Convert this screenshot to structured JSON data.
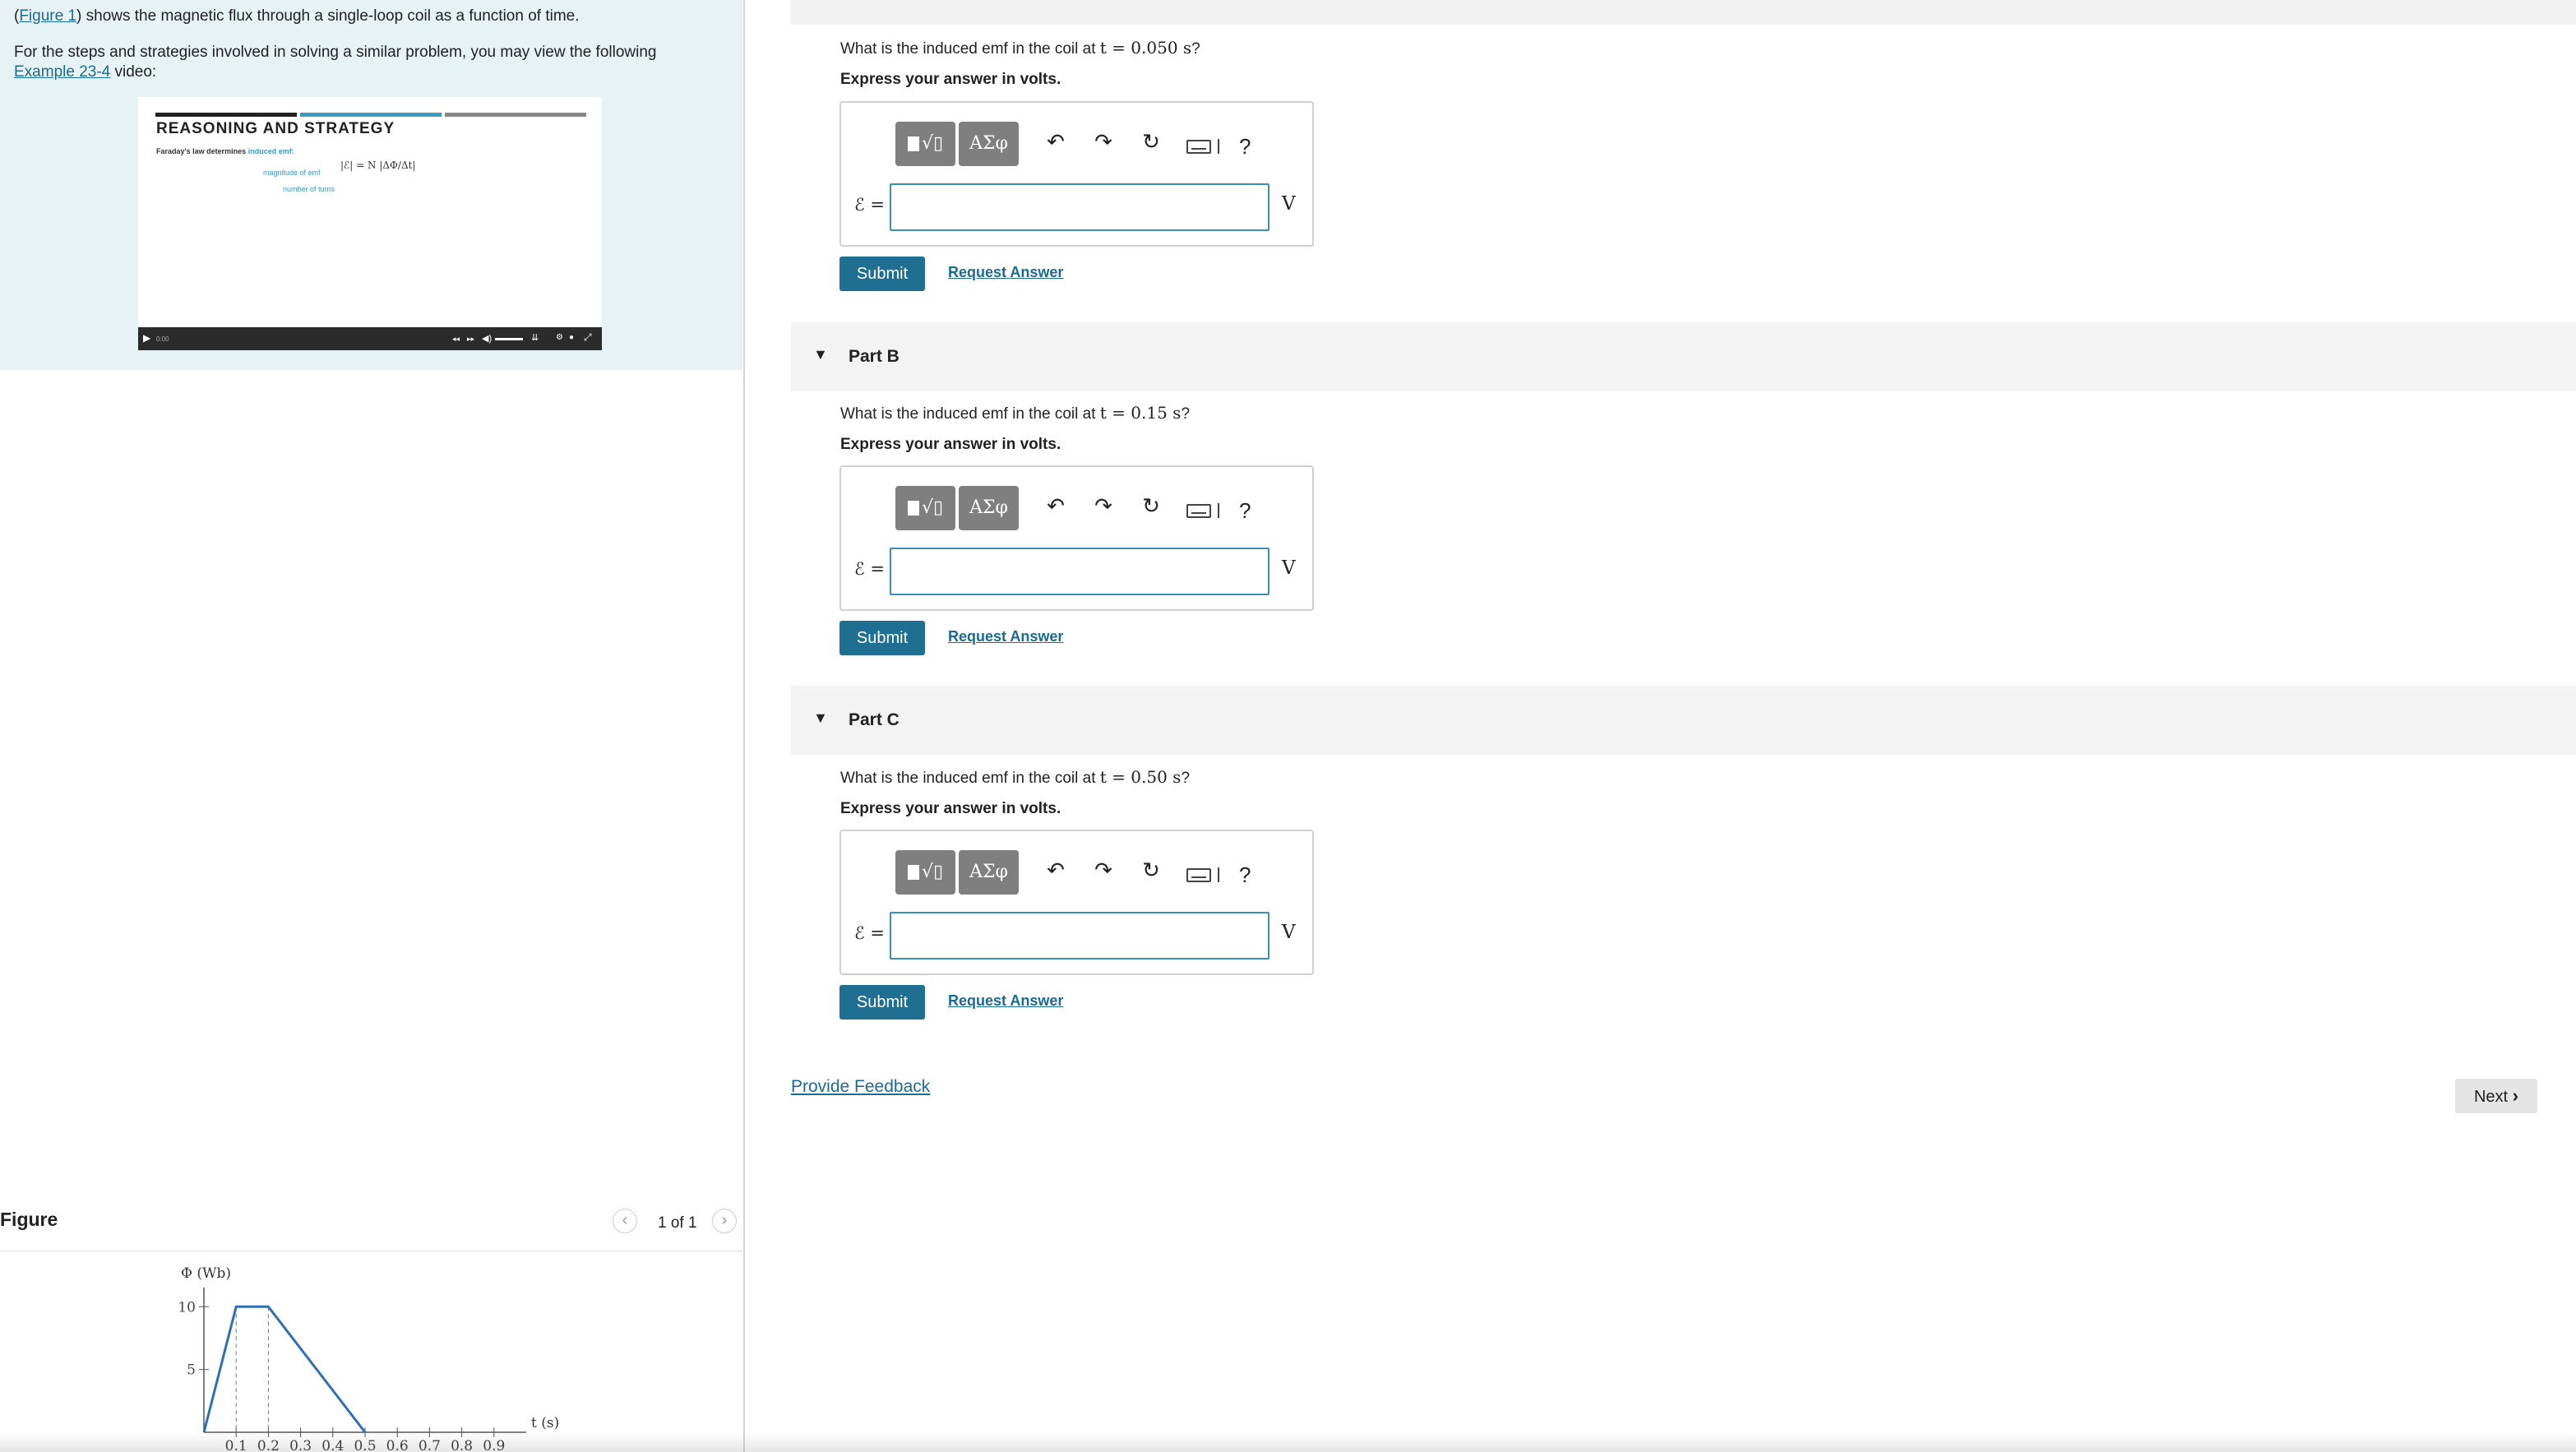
{
  "intro": {
    "figure_link": "Figure 1",
    "line1_open": "(",
    "line1_rest": ") shows the magnetic flux through a single-loop coil as a function of time.",
    "line2": "For the steps and strategies involved in solving a similar problem, you may view the following",
    "example_link": "Example 23-4",
    "line3_rest": " video:"
  },
  "video": {
    "heading": "REASONING AND STRATEGY",
    "sub_text": "Faraday's law determines",
    "sub_highlight": "induced emf:",
    "label_magnitude": "magnitude of emf",
    "label_turns": "number of turns",
    "formula": "|ℰ| = N |ΔΦ/Δt|",
    "colors": {
      "bar_dark": "#222222",
      "bar_blue": "#3a9bc2",
      "bar_gray": "#888888"
    }
  },
  "figure": {
    "title": "Figure",
    "pager": "1 of 1",
    "prev_icon": "chevron-left-icon",
    "next_icon": "chevron-right-icon"
  },
  "chart_data": {
    "type": "line",
    "ylabel": "Φ (Wb)",
    "xlabel": "t (s)",
    "y_ticks": [
      "10",
      "5"
    ],
    "x_ticks": [
      "0.1",
      "0.2",
      "0.3",
      "0.4",
      "0.5",
      "0.6",
      "0.7",
      "0.8",
      "0.9"
    ],
    "xlim": [
      0,
      1.0
    ],
    "ylim": [
      0,
      11
    ],
    "series": [
      {
        "x": [
          0,
          0.1,
          0.2,
          0.5
        ],
        "y": [
          0,
          10,
          10,
          0
        ]
      }
    ],
    "line_color": "#2f6fb5"
  },
  "parts": [
    {
      "id": "A",
      "header": "",
      "question_pre": "What is the induced emf in the coil at",
      "question_math": "t = 0.050 s",
      "question_post": "?",
      "instruction": "Express your answer in volts.",
      "symbol": "ℰ =",
      "unit": "V",
      "value": "",
      "submit": "Submit",
      "request": "Request Answer"
    },
    {
      "id": "B",
      "header": "Part B",
      "question_pre": "What is the induced emf in the coil at",
      "question_math": "t = 0.15 s",
      "question_post": "?",
      "instruction": "Express your answer in volts.",
      "symbol": "ℰ =",
      "unit": "V",
      "value": "",
      "submit": "Submit",
      "request": "Request Answer"
    },
    {
      "id": "C",
      "header": "Part C",
      "question_pre": "What is the induced emf in the coil at",
      "question_math": "t = 0.50 s",
      "question_post": "?",
      "instruction": "Express your answer in volts.",
      "symbol": "ℰ =",
      "unit": "V",
      "value": "",
      "submit": "Submit",
      "request": "Request Answer"
    }
  ],
  "toolbar": {
    "templates_icon": "templates-icon",
    "symbols_label": "ΑΣφ",
    "undo_icon": "undo-icon",
    "redo_icon": "redo-icon",
    "reset_icon": "reset-icon",
    "keyboard_icon": "keyboard-icon",
    "help_label": "?"
  },
  "footer": {
    "feedback": "Provide Feedback",
    "next": "Next"
  },
  "colors": {
    "accent": "#1f6f93",
    "link": "#1a6b93",
    "intro_bg": "#e6f2f4"
  }
}
